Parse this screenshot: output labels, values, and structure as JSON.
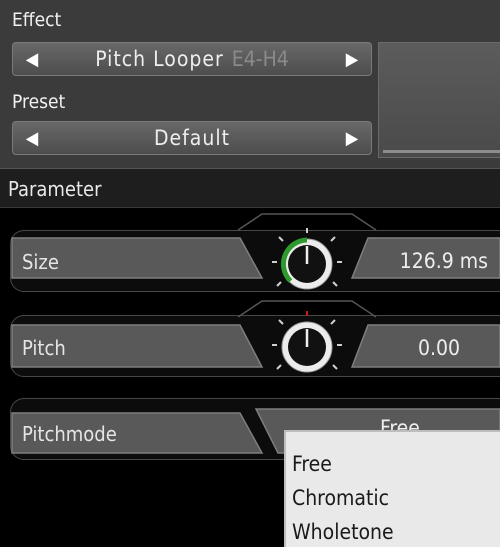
{
  "effect": {
    "label": "Effect",
    "name": "Pitch Looper",
    "range": "E4-H4",
    "prev_icon": "left-triangle-icon",
    "next_icon": "right-triangle-icon"
  },
  "preset": {
    "label": "Preset",
    "name": "Default"
  },
  "parameter_section": {
    "title": "Parameter"
  },
  "params": [
    {
      "name": "Size",
      "value": "126.9 ms",
      "knob_level": 0.55,
      "knob_color": "#2e9a2e"
    },
    {
      "name": "Pitch",
      "value": "0.00",
      "knob_level": 0.5,
      "knob_color": "#d01818"
    },
    {
      "name": "Pitchmode",
      "value": "Free"
    }
  ],
  "pitchmode_dropdown": {
    "options": [
      "Free",
      "Chromatic",
      "Wholetone"
    ]
  },
  "colors": {
    "header_bg": "#3b3b3b",
    "panel_bg": "#000000",
    "knob_accent_size": "#2e9a2e",
    "knob_accent_pitch": "#d01818",
    "dropdown_bg": "#e9e9e9"
  }
}
